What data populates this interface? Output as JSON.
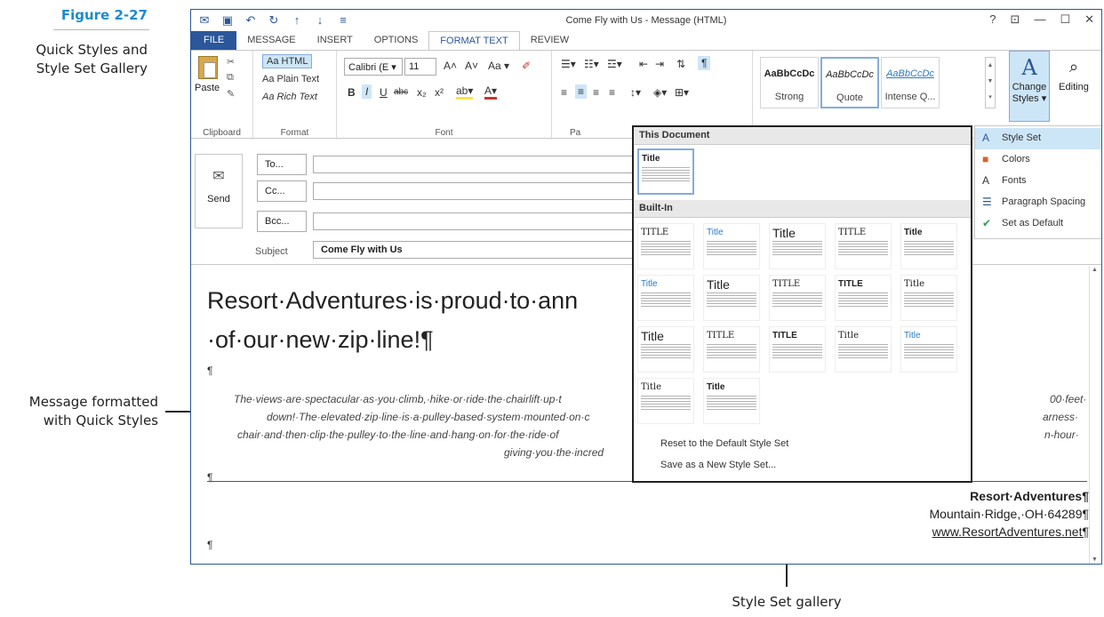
{
  "figure": {
    "number": "Figure 2-27",
    "description": "Quick Styles and Style Set Gallery",
    "callout_left": "Message formatted with Quick Styles",
    "callout_bottom": "Style Set gallery"
  },
  "window": {
    "title": "Come Fly with Us - Message (HTML)",
    "controls": [
      "?",
      "⊡",
      "—",
      "☐",
      "✕"
    ]
  },
  "tabs": [
    "FILE",
    "MESSAGE",
    "INSERT",
    "OPTIONS",
    "FORMAT TEXT",
    "REVIEW"
  ],
  "ribbon": {
    "paste": "Paste",
    "format_items": [
      "Aa HTML",
      "Aa Plain Text",
      "Aa Rich Text"
    ],
    "font_name": "Calibri (E ▾",
    "font_size": "11",
    "groups": [
      "Clipboard",
      "Format",
      "Font",
      "Pa"
    ],
    "style_tiles": [
      {
        "sample": "AaBbCcDc",
        "name": "Strong"
      },
      {
        "sample": "AaBbCcDc",
        "name": "Quote"
      },
      {
        "sample": "AaBbCcDc",
        "name": "Intense Q..."
      }
    ],
    "change_styles": "Change Styles ▾",
    "editing": "Editing"
  },
  "header": {
    "send": "Send",
    "to": "To...",
    "cc": "Cc...",
    "bcc": "Bcc...",
    "subject_label": "Subject",
    "subject_value": "Come Fly with Us"
  },
  "body": {
    "headline_1": "Resort·Adventures·is·proud·to·ann",
    "headline_2": "·of·our·new·zip·line!¶",
    "pilcrow": "¶",
    "italic_1": "The·views·are·spectacular·as·you·climb,·hike·or·ride·the·chairlift·up·t",
    "italic_1_end": "00·feet·",
    "italic_2": "down!·The·elevated·zip·line·is·a·pulley-based·system·mounted·on·c",
    "italic_2_end": "arness·",
    "italic_3": "chair·and·then·clip·the·pulley·to·the·line·and·hang·on·for·the·ride·of",
    "italic_3_end": "n-hour·",
    "italic_4": "giving·you·the·incred",
    "sig_1": "Resort·Adventures¶",
    "sig_2": "Mountain·Ridge,·OH·64289¶",
    "sig_3": "www.ResortAdventures.net¶"
  },
  "gallery": {
    "section_1": "This Document",
    "section_2": "Built-In",
    "current_title": "Title",
    "thumb_titles": [
      "TITLE",
      "Title",
      "Title",
      "TITLE",
      "Title",
      "Title",
      "Title",
      "TITLE",
      "TITLE",
      "Title",
      "Title",
      "TITLE",
      "TITLE",
      "Title",
      "Title",
      "Title",
      "Title"
    ],
    "reset": "Reset to the Default Style Set",
    "save": "Save as a New Style Set..."
  },
  "dropdown": {
    "items": [
      "Style Set",
      "Colors",
      "Fonts",
      "Paragraph Spacing",
      "Set as Default"
    ]
  },
  "colors": {
    "accent": "#2b579a",
    "figure_blue": "#1b8ccf",
    "selection": "#cde6f7"
  }
}
